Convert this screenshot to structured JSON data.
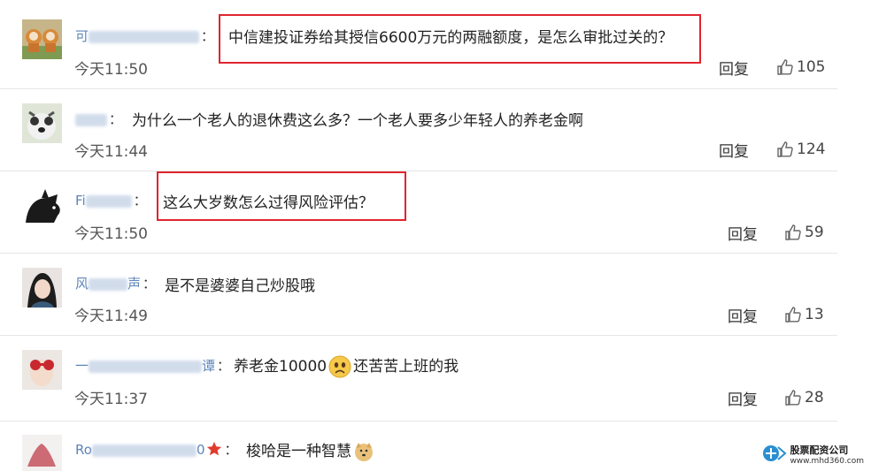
{
  "comments": [
    {
      "nickname_visible": "可",
      "nickname_tail": "",
      "text": "中信建投证券给其授信6600万元的两融额度，是怎么审批过关的？",
      "time": "今天11:50",
      "reply_label": "回复",
      "likes": "105",
      "highlighted": true
    },
    {
      "nickname_visible": "",
      "nickname_tail": "",
      "text": "为什么一个老人的退休费这么多？一个老人要多少年轻人的养老金啊",
      "time": "今天11:44",
      "reply_label": "回复",
      "likes": "124",
      "highlighted": false
    },
    {
      "nickname_visible": "Fi",
      "nickname_tail": "",
      "text": "这么大岁数怎么过得风险评估？",
      "time": "今天11:50",
      "reply_label": "回复",
      "likes": "59",
      "highlighted": true
    },
    {
      "nickname_visible": "风",
      "nickname_tail": "声",
      "text": "是不是婆婆自己炒股哦",
      "time": "今天11:49",
      "reply_label": "回复",
      "likes": "13",
      "highlighted": false
    },
    {
      "nickname_visible": "一",
      "nickname_tail": "谭",
      "text_before": "养老金10000",
      "text_after": "还苦苦上班的我",
      "emoji": "sad-face-icon",
      "time": "今天11:37",
      "reply_label": "回复",
      "likes": "28",
      "highlighted": false
    },
    {
      "nickname_visible": "Ro",
      "nickname_tail": "0",
      "text": "梭哈是一种智慧",
      "emoji": "doge-icon",
      "badge": "star-icon",
      "time": "",
      "reply_label": "",
      "likes": "",
      "highlighted": false
    }
  ],
  "colon": "：",
  "watermark": {
    "name": "股票配资公司",
    "url": "www.mhd360.com"
  },
  "colors": {
    "link": "#5d84b8",
    "highlight": "#e0252e",
    "divider": "#e6e6e6"
  }
}
